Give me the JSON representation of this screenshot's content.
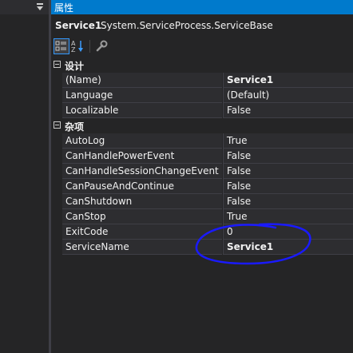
{
  "panel": {
    "title": "属性",
    "object_name": "Service1",
    "object_type": "System.ServiceProcess.ServiceBase"
  },
  "toolbar": {
    "buttons": [
      {
        "icon": "categorized-icon",
        "active": true
      },
      {
        "icon": "alphabetical-sort-icon",
        "active": false
      },
      {
        "icon": "property-pages-wrench-icon",
        "active": false
      }
    ]
  },
  "categories": [
    {
      "label": "设计",
      "properties": [
        {
          "name": "(Name)",
          "value": "Service1",
          "bold": true
        },
        {
          "name": "Language",
          "value": "(Default)",
          "bold": false
        },
        {
          "name": "Localizable",
          "value": "False",
          "bold": false
        }
      ]
    },
    {
      "label": "杂项",
      "properties": [
        {
          "name": "AutoLog",
          "value": "True",
          "bold": false
        },
        {
          "name": "CanHandlePowerEvent",
          "value": "False",
          "bold": false
        },
        {
          "name": "CanHandleSessionChangeEvent",
          "value": "False",
          "bold": false
        },
        {
          "name": "CanPauseAndContinue",
          "value": "False",
          "bold": false
        },
        {
          "name": "CanShutdown",
          "value": "False",
          "bold": false
        },
        {
          "name": "CanStop",
          "value": "True",
          "bold": false
        },
        {
          "name": "ExitCode",
          "value": "0",
          "bold": false
        },
        {
          "name": "ServiceName",
          "value": "Service1",
          "bold": true
        }
      ]
    }
  ],
  "colors": {
    "accent": "#007acc",
    "annotation": "#1a1aff",
    "background": "#252526"
  }
}
